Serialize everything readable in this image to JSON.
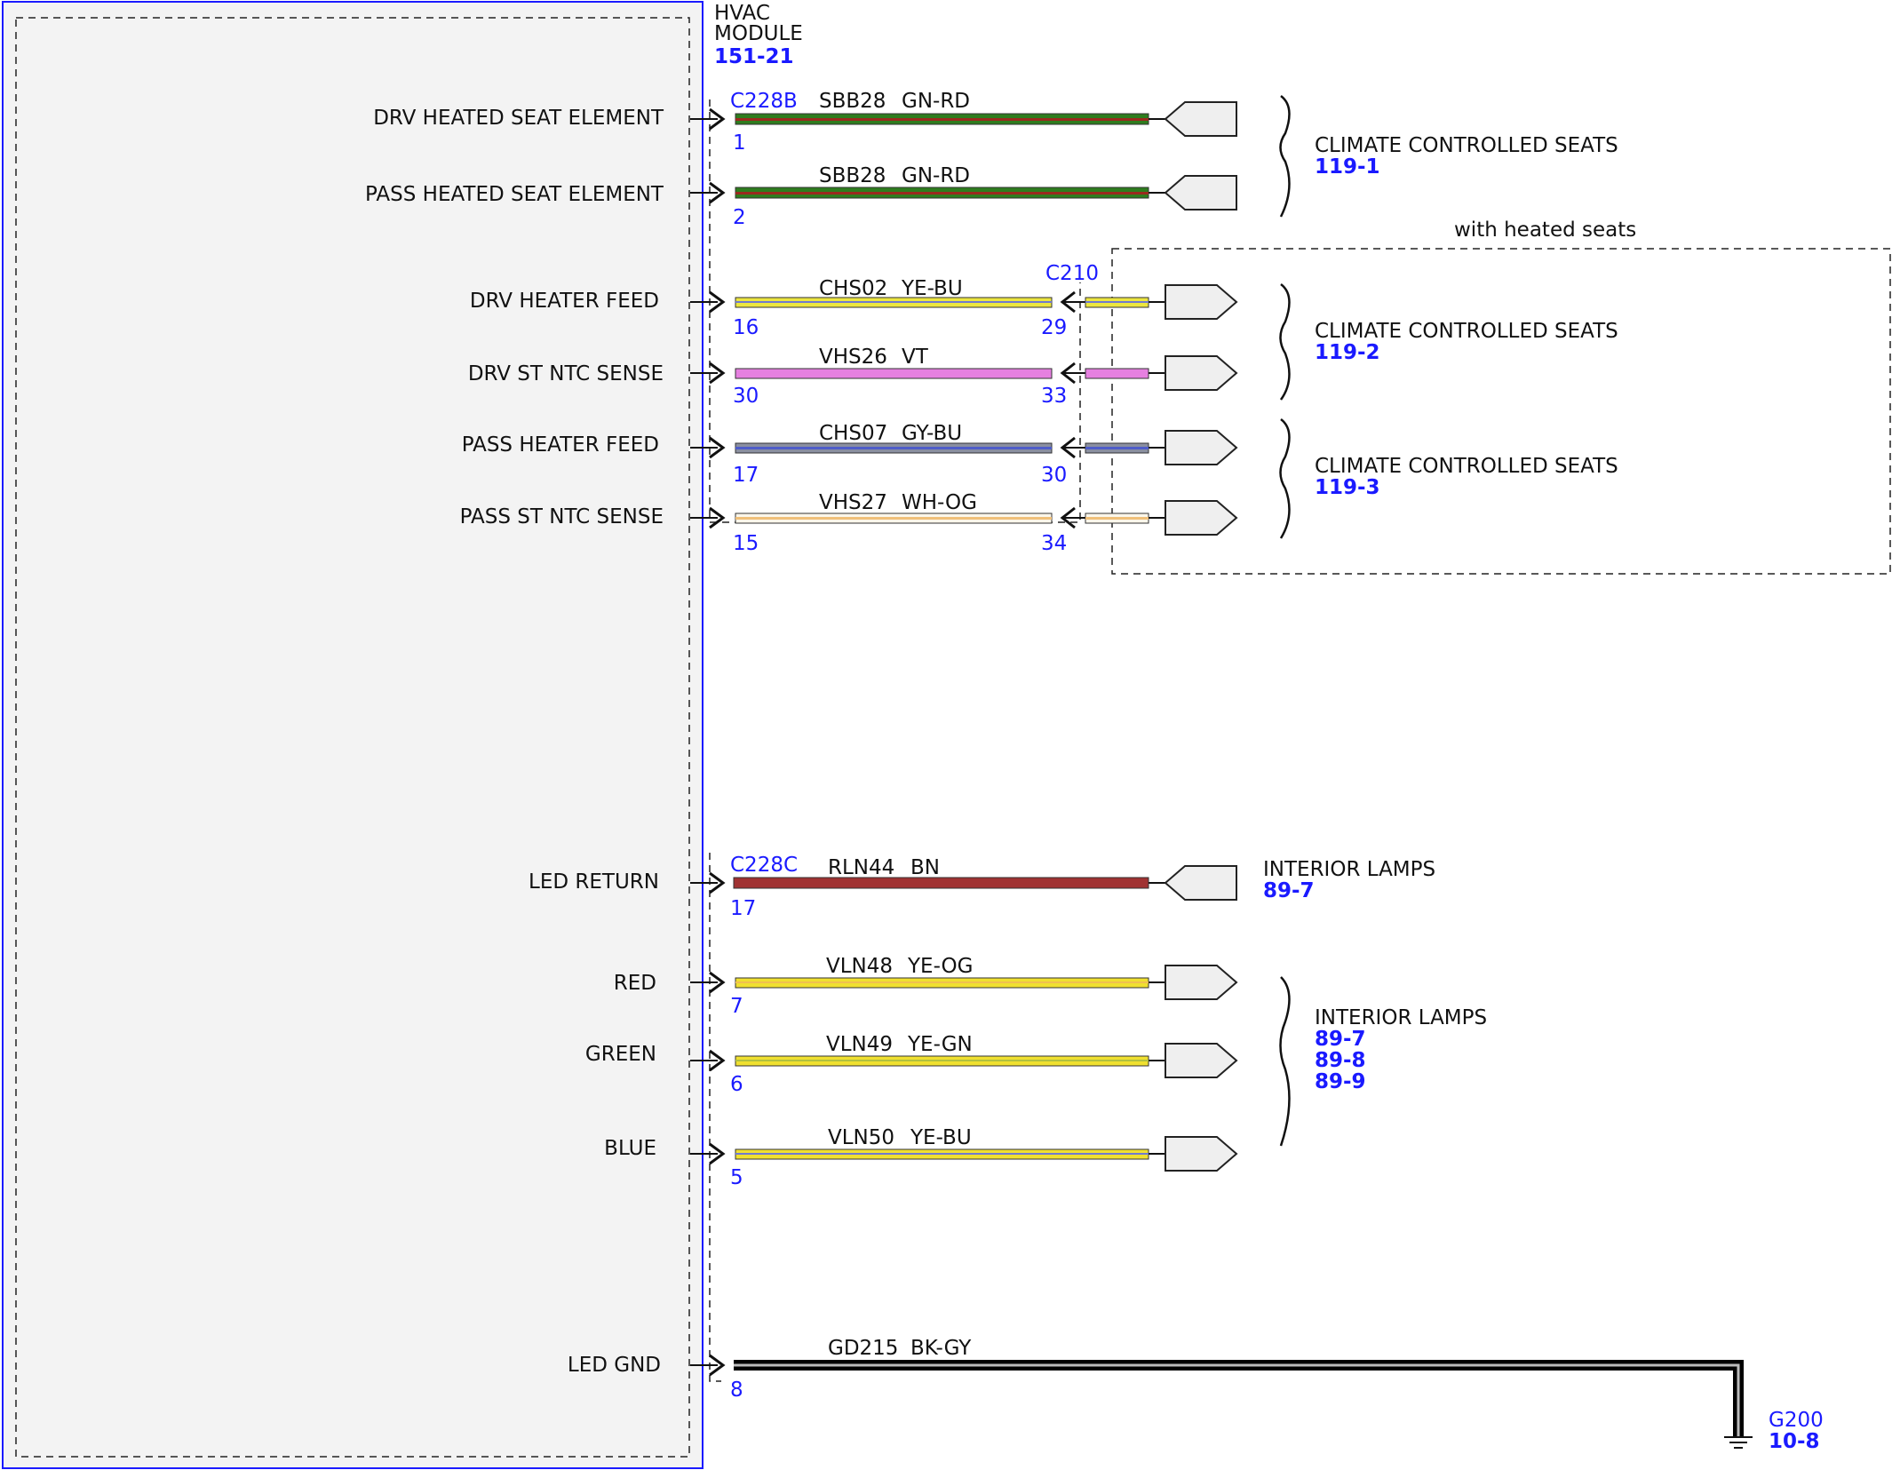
{
  "module": {
    "title_line1": "HVAC",
    "title_line2": "MODULE",
    "ref": "151-21"
  },
  "connectors": {
    "c228b": "C228B",
    "c228c": "C228C",
    "c210": "C210"
  },
  "option_label": "with heated seats",
  "signals": [
    {
      "label": "DRV HEATED SEAT ELEMENT",
      "pin": "1",
      "circuit": "SBB28",
      "color_code": "GN-RD"
    },
    {
      "label": "PASS HEATED SEAT ELEMENT",
      "pin": "2",
      "circuit": "SBB28",
      "color_code": "GN-RD"
    },
    {
      "label": "DRV HEATER FEED",
      "pin": "16",
      "circuit": "CHS02",
      "color_code": "YE-BU",
      "c210_pin": "29"
    },
    {
      "label": "DRV ST NTC SENSE",
      "pin": "30",
      "circuit": "VHS26",
      "color_code": "VT",
      "c210_pin": "33"
    },
    {
      "label": "PASS HEATER FEED",
      "pin": "17",
      "circuit": "CHS07",
      "color_code": "GY-BU",
      "c210_pin": "30"
    },
    {
      "label": "PASS ST NTC SENSE",
      "pin": "15",
      "circuit": "VHS27",
      "color_code": "WH-OG",
      "c210_pin": "34"
    },
    {
      "label": "LED RETURN",
      "pin": "17",
      "circuit": "RLN44",
      "color_code": "BN"
    },
    {
      "label": "RED",
      "pin": "7",
      "circuit": "VLN48",
      "color_code": "YE-OG"
    },
    {
      "label": "GREEN",
      "pin": "6",
      "circuit": "VLN49",
      "color_code": "YE-GN"
    },
    {
      "label": "BLUE",
      "pin": "5",
      "circuit": "VLN50",
      "color_code": "YE-BU"
    },
    {
      "label": "LED GND",
      "pin": "8",
      "circuit": "GD215",
      "color_code": "BK-GY"
    }
  ],
  "destinations": {
    "seats1": {
      "name": "CLIMATE CONTROLLED SEATS",
      "ref": "119-1"
    },
    "seats2": {
      "name": "CLIMATE CONTROLLED SEATS",
      "ref": "119-2"
    },
    "seats3": {
      "name": "CLIMATE CONTROLLED SEATS",
      "ref": "119-3"
    },
    "lamps1": {
      "name": "INTERIOR LAMPS",
      "ref": "89-7"
    },
    "lamps2": {
      "name": "INTERIOR LAMPS",
      "refs": [
        "89-7",
        "89-8",
        "89-9"
      ]
    }
  },
  "ground": {
    "name": "G200",
    "ref": "10-8"
  },
  "colors": {
    "module_border": "#1a1aff",
    "module_fill": "#f3f3f3",
    "ref_text": "#1a1aff",
    "wire_gn_rd": [
      "#2e7d1e",
      "#9a2a1e"
    ],
    "wire_ye_bu": [
      "#ece640",
      "#6f7bd0"
    ],
    "wire_vt": [
      "#e680e0",
      "#e680e0"
    ],
    "wire_gy_bu": [
      "#8a8fa0",
      "#4e5cc8"
    ],
    "wire_wh_og": [
      "#fbf6ea",
      "#f0c07a"
    ],
    "wire_bn": [
      "#a03232",
      "#a03232"
    ],
    "wire_ye_og": [
      "#f0e030",
      "#f0c050"
    ],
    "wire_ye_gn": [
      "#f0e030",
      "#b0c040"
    ],
    "wire_bk_gy": [
      "#000000",
      "#bbbbbb"
    ]
  }
}
